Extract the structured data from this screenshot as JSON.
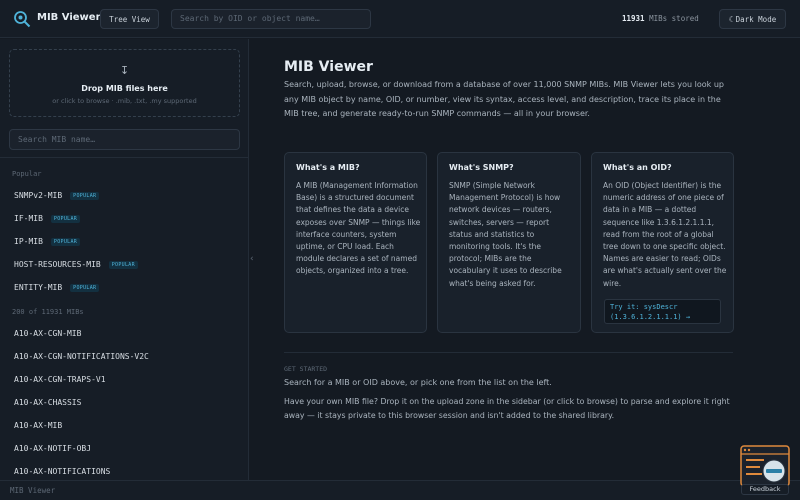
{
  "header": {
    "app_title": "MIB Viewer",
    "tree_view_label": "Tree View",
    "search_placeholder": "Search by OID or object name…",
    "mib_count": "11931",
    "mib_count_suffix": "MIBs stored",
    "dark_mode_label": "Dark Mode"
  },
  "sidebar": {
    "drop_title": "Drop MIB files here",
    "drop_subtitle": "or click to browse · .mib, .txt, .my supported",
    "search_placeholder": "Search MIB name…",
    "popular_label": "Popular",
    "popular_badge": "POPULAR",
    "popular": [
      "SNMPv2-MIB",
      "IF-MIB",
      "IP-MIB",
      "HOST-RESOURCES-MIB",
      "ENTITY-MIB"
    ],
    "list_label": "200 of 11931 MIBs",
    "list": [
      "A10-AX-CGN-MIB",
      "A10-AX-CGN-NOTIFICATIONS-V2C",
      "A10-AX-CGN-TRAPS-V1",
      "A10-AX-CHASSIS",
      "A10-AX-MIB",
      "A10-AX-NOTIF-OBJ",
      "A10-AX-NOTIFICATIONS"
    ]
  },
  "main": {
    "title": "MIB Viewer",
    "intro": "Search, upload, browse, or download from a database of over 11,000 SNMP MIBs. MIB Viewer lets you look up any MIB object by name, OID, or number, view its syntax, access level, and description, trace its place in the MIB tree, and generate ready-to-run SNMP commands — all in your browser.",
    "cards": [
      {
        "heading": "What's a MIB?",
        "body": "A MIB (Management Information Base) is a structured document that defines the data a device exposes over SNMP — things like interface counters, system uptime, or CPU load. Each module declares a set of named objects, organized into a tree."
      },
      {
        "heading": "What's SNMP?",
        "body": "SNMP (Simple Network Management Protocol) is how network devices — routers, switches, servers — report status and statistics to monitoring tools. It's the protocol; MIBs are the vocabulary it uses to describe what's being asked for."
      },
      {
        "heading": "What's an OID?",
        "body": "An OID (Object Identifier) is the numeric address of one piece of data in a MIB — a dotted sequence like 1.3.6.1.2.1.1.1, read from the root of a global tree down to one specific object. Names are easier to read; OIDs are what's actually sent over the wire."
      }
    ],
    "try_line1": "Try it: sysDescr",
    "try_line2": "(1.3.6.1.2.1.1.1) →",
    "get_started_label": "GET STARTED",
    "get_started_1": "Search for a MIB or OID above, or pick one from the list on the left.",
    "get_started_2": "Have your own MIB file? Drop it on the upload zone in the sidebar (or click to browse) to parse and explore it right away — it stays private to this browser session and isn't added to the shared library."
  },
  "footer": {
    "text": "MIB Viewer",
    "feedback_label": "Feedback"
  },
  "colors": {
    "accent": "#4fb3d9",
    "background": "#141a22",
    "panel": "#161d26",
    "feedback_icon": "#e08a3c"
  }
}
